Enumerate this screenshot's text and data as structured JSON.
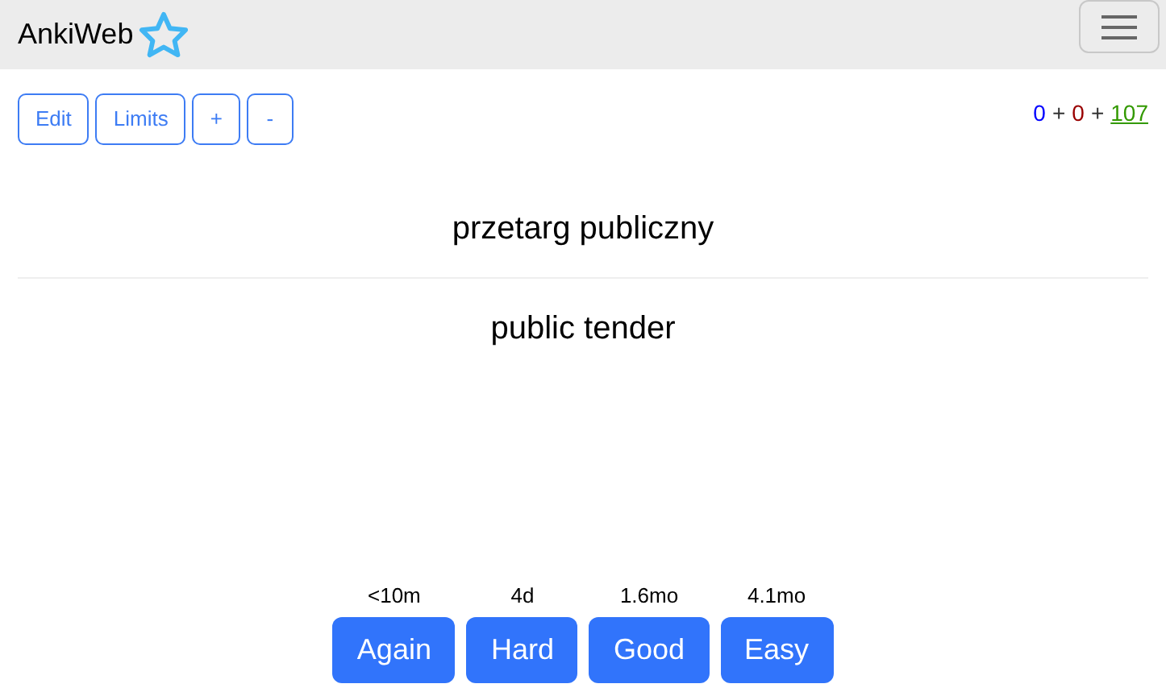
{
  "navbar": {
    "brand": "AnkiWeb"
  },
  "toolbar": {
    "buttons": [
      "Edit",
      "Limits",
      "+",
      "-"
    ]
  },
  "counts": [
    {
      "value": "0",
      "color": "#0000ff",
      "selected": false
    },
    {
      "value": "0",
      "color": "#990000",
      "selected": false
    },
    {
      "value": "107",
      "color": "#339900",
      "selected": true
    }
  ],
  "count_separator": "+",
  "card": {
    "front": "przetarg publiczny",
    "back": "public tender"
  },
  "answers": [
    {
      "interval": "<10m",
      "label": "Again"
    },
    {
      "interval": "4d",
      "label": "Hard"
    },
    {
      "interval": "1.6mo",
      "label": "Good"
    },
    {
      "interval": "4.1mo",
      "label": "Easy"
    }
  ]
}
